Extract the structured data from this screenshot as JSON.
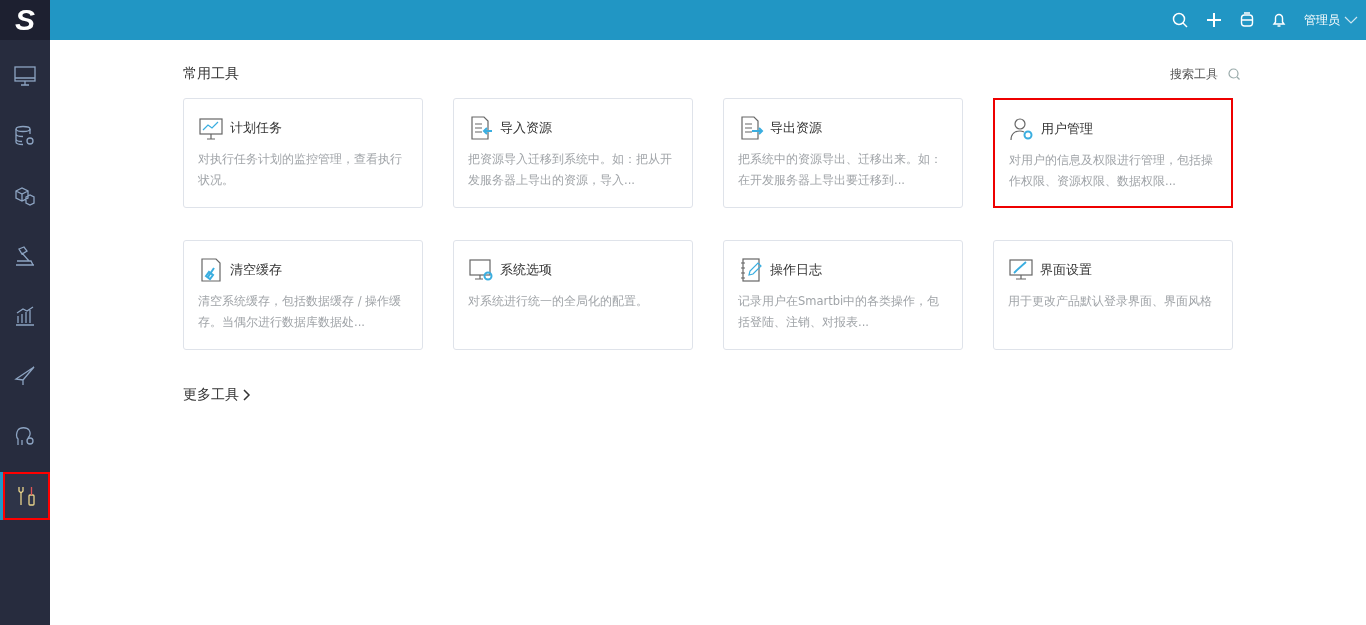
{
  "logo": {
    "letter": "S"
  },
  "topbar": {
    "user": "管理员"
  },
  "sidebar": {
    "items": [
      {
        "kind": "monitor",
        "selected": false,
        "highlighted": false
      },
      {
        "kind": "database",
        "selected": false,
        "highlighted": false
      },
      {
        "kind": "cubes",
        "selected": false,
        "highlighted": false
      },
      {
        "kind": "hammer",
        "selected": false,
        "highlighted": false
      },
      {
        "kind": "chart",
        "selected": false,
        "highlighted": false
      },
      {
        "kind": "plane",
        "selected": false,
        "highlighted": false
      },
      {
        "kind": "person",
        "selected": false,
        "highlighted": false
      },
      {
        "kind": "tools",
        "selected": true,
        "highlighted": true
      }
    ]
  },
  "section": {
    "title": "常用工具",
    "search_label": "搜索工具"
  },
  "tools": [
    {
      "kind": "chart",
      "title": "计划任务",
      "description": "对执行任务计划的监控管理，查看执行状况。",
      "highlighted": false
    },
    {
      "kind": "import",
      "title": "导入资源",
      "description": "把资源导入迁移到系统中。如：把从开发服务器上导出的资源，导入...",
      "highlighted": false
    },
    {
      "kind": "export",
      "title": "导出资源",
      "description": "把系统中的资源导出、迁移出来。如：在开发服务器上导出要迁移到...",
      "highlighted": false
    },
    {
      "kind": "user",
      "title": "用户管理",
      "description": "对用户的信息及权限进行管理，包括操作权限、资源权限、数据权限...",
      "highlighted": true
    },
    {
      "kind": "broom",
      "title": "清空缓存",
      "description": "清空系统缓存，包括数据缓存 / 操作缓存。当偶尔进行数据库数据处...",
      "highlighted": false
    },
    {
      "kind": "settings",
      "title": "系统选项",
      "description": "对系统进行统一的全局化的配置。",
      "highlighted": false
    },
    {
      "kind": "log",
      "title": "操作日志",
      "description": "记录用户在Smartbi中的各类操作，包括登陆、注销、对报表...",
      "highlighted": false
    },
    {
      "kind": "screen",
      "title": "界面设置",
      "description": "用于更改产品默认登录界面、界面风格",
      "highlighted": false
    }
  ],
  "more_link": "更多工具"
}
